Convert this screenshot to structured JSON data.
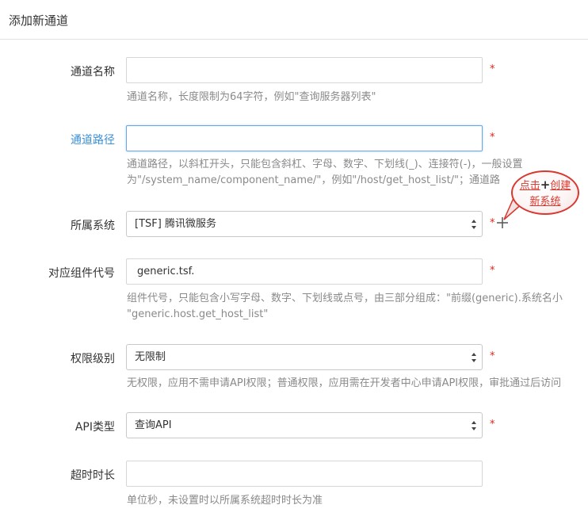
{
  "header": {
    "title": "添加新通道"
  },
  "fields": {
    "channel_name": {
      "label": "通道名称",
      "value": "",
      "required": "*",
      "help": "通道名称，长度限制为64字符，例如\"查询服务器列表\""
    },
    "channel_path": {
      "label": "通道路径",
      "value": "",
      "required": "*",
      "help_line1": "通道路径，以斜杠开头，只能包含斜杠、字母、数字、下划线(_)、连接符(-)，一般设置",
      "help_line2": "为\"/system_name/component_name/\"，例如\"/host/get_host_list/\"；通道路"
    },
    "system": {
      "label": "所属系统",
      "selected": "[TSF] 腾讯微服务",
      "required": "*"
    },
    "component_code": {
      "label": "对应组件代号",
      "value": "generic.tsf.",
      "required": "*",
      "help_line1": "组件代号，只能包含小写字母、数字、下划线或点号，由三部分组成：\"前缀(generic).系统名小",
      "help_line2": "\"generic.host.get_host_list\""
    },
    "permission_level": {
      "label": "权限级别",
      "selected": "无限制",
      "required": "*",
      "help": "无权限，应用不需申请API权限；普通权限，应用需在开发者中心申请API权限，审批通过后访问"
    },
    "api_type": {
      "label": "API类型",
      "selected": "查询API",
      "required": "*"
    },
    "timeout": {
      "label": "超时时长",
      "value": "",
      "help": "单位秒，未设置时以所属系统超时时长为准"
    }
  },
  "callout": {
    "text_part1": "点击",
    "plus_symbol": "+",
    "text_part2": "创建",
    "text_line2": "新系统",
    "color": "#d9382f"
  },
  "colors": {
    "active_label": "#3b8fd6",
    "required": "#e0271b",
    "help_text": "#8a8a8a"
  }
}
